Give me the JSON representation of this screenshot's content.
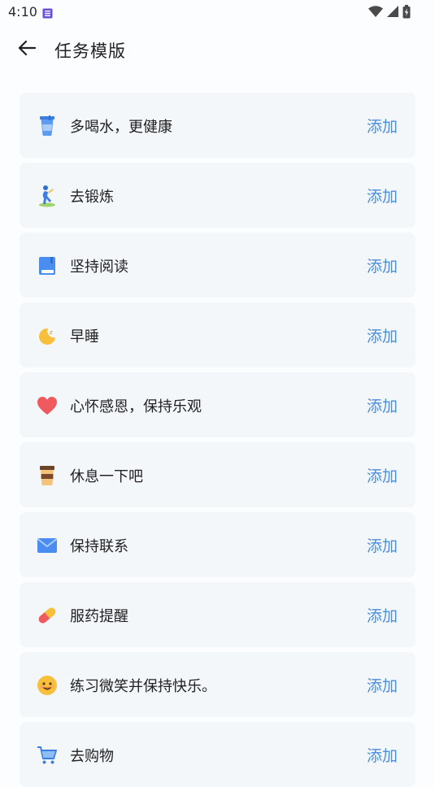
{
  "status_bar": {
    "time": "4:10"
  },
  "header": {
    "title": "任务模版"
  },
  "colors": {
    "accent": "#4a8ee0",
    "card_bg": "#f4f7fa"
  },
  "templates": [
    {
      "label": "多喝水，更健康",
      "action": "添加",
      "icon": "water-cup-icon"
    },
    {
      "label": "去锻炼",
      "action": "添加",
      "icon": "exercise-icon"
    },
    {
      "label": "坚持阅读",
      "action": "添加",
      "icon": "book-icon"
    },
    {
      "label": "早睡",
      "action": "添加",
      "icon": "moon-icon"
    },
    {
      "label": "心怀感恩，保持乐观",
      "action": "添加",
      "icon": "heart-icon"
    },
    {
      "label": "休息一下吧",
      "action": "添加",
      "icon": "coffee-icon"
    },
    {
      "label": "保持联系",
      "action": "添加",
      "icon": "mail-icon"
    },
    {
      "label": "服药提醒",
      "action": "添加",
      "icon": "pill-icon"
    },
    {
      "label": "练习微笑并保持快乐。",
      "action": "添加",
      "icon": "smile-icon"
    },
    {
      "label": "去购物",
      "action": "添加",
      "icon": "cart-icon"
    }
  ]
}
